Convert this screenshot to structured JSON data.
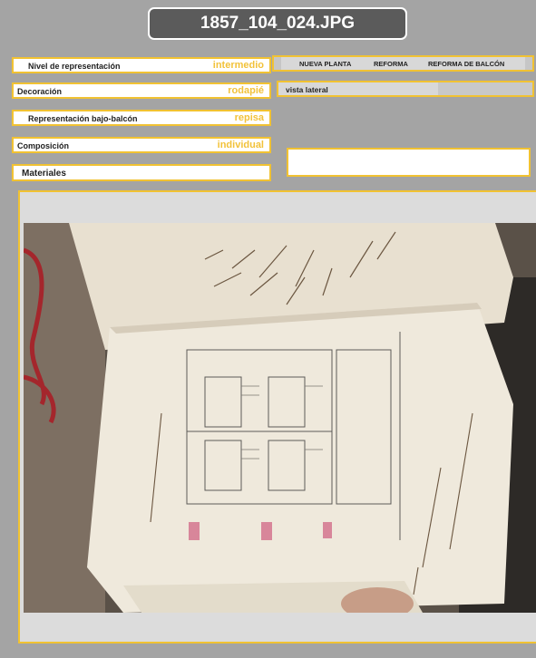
{
  "title": "1857_104_024.JPG",
  "fields": {
    "nivel": {
      "label": "Nivel de representación",
      "value": "intermedio"
    },
    "decoracion": {
      "label": "Decoración",
      "value": "rodapié"
    },
    "bajo_balcon": {
      "label": "Representación bajo-balcón",
      "value": "repisa"
    },
    "composicion": {
      "label": "Composición",
      "value": "individual"
    },
    "materiales": {
      "label": "Materiales",
      "value": ""
    }
  },
  "tabs": [
    "NUEVA PLANTA",
    "REFORMA",
    "REFORMA DE  BALCÓN"
  ],
  "view_label": "vista lateral",
  "colors": {
    "accent": "#f1c232",
    "title_bg": "#5b5b5b",
    "page_bg": "#a4a4a4"
  }
}
